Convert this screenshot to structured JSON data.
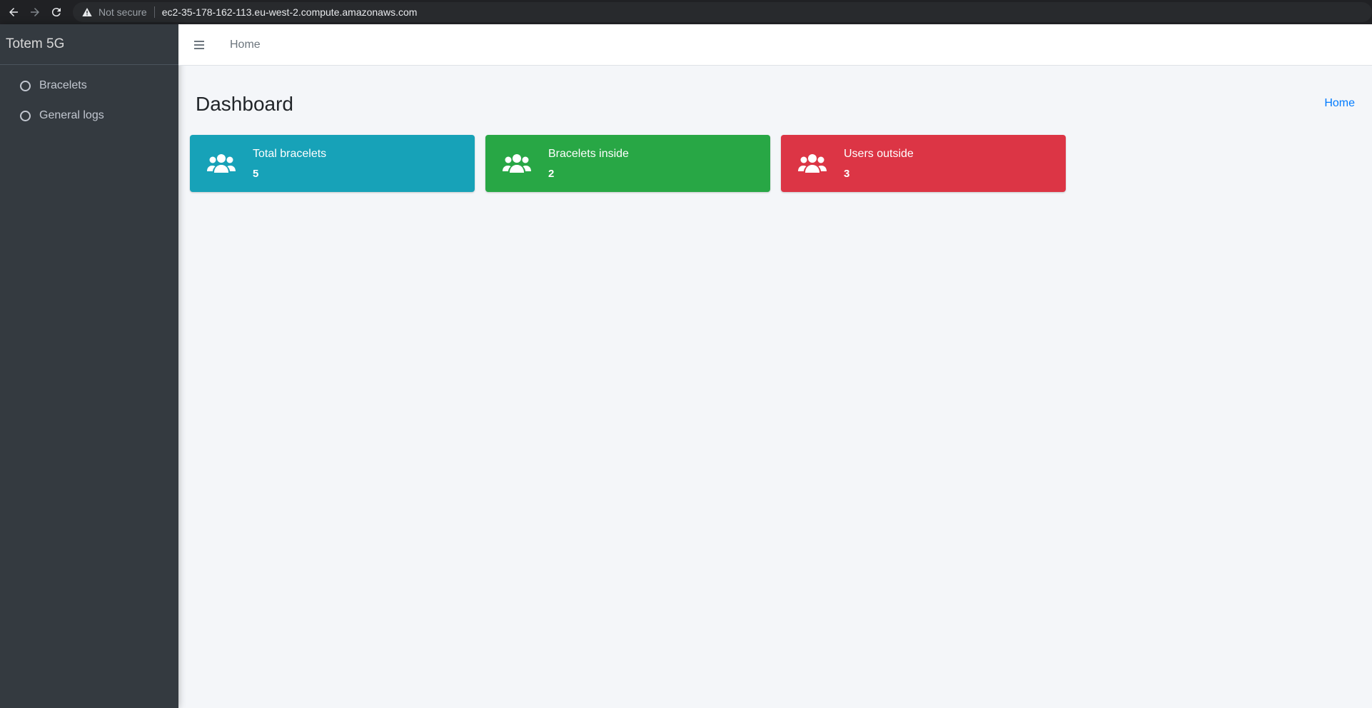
{
  "browser": {
    "security_label": "Not secure",
    "url": "ec2-35-178-162-113.eu-west-2.compute.amazonaws.com"
  },
  "sidebar": {
    "brand": "Totem 5G",
    "items": [
      {
        "label": "Bracelets"
      },
      {
        "label": "General logs"
      }
    ]
  },
  "topbar": {
    "home_link": "Home"
  },
  "main": {
    "title": "Dashboard",
    "breadcrumb": "Home",
    "boxes": [
      {
        "label": "Total bracelets",
        "value": "5",
        "color": "#17a2b8",
        "icon": "users-icon"
      },
      {
        "label": "Bracelets inside",
        "value": "2",
        "color": "#28a745",
        "icon": "users-icon"
      },
      {
        "label": "Users outside",
        "value": "3",
        "color": "#dc3545",
        "icon": "users-icon"
      }
    ]
  }
}
